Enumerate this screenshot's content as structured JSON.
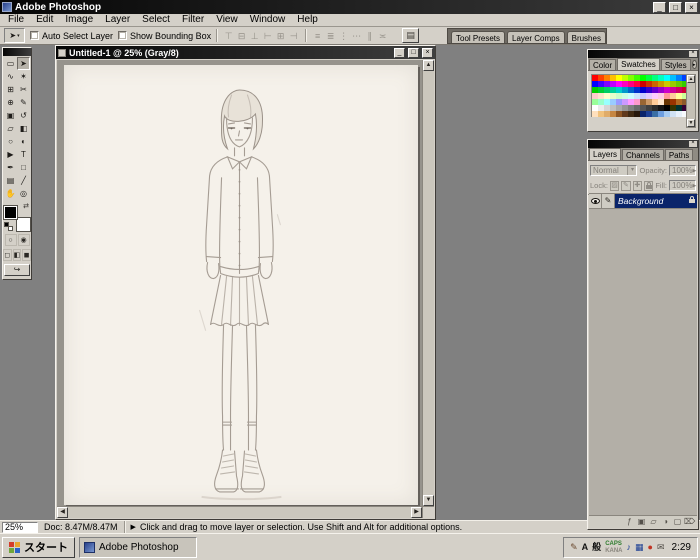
{
  "app": {
    "title": "Adobe Photoshop",
    "window_controls": [
      "_",
      "□",
      "×"
    ]
  },
  "glyphs": {
    "up": "▲",
    "down": "▼",
    "left": "◀",
    "right": "▶",
    "close": "×",
    "menu": "▸",
    "dropdown": "▾"
  },
  "menu": {
    "items": [
      "File",
      "Edit",
      "Image",
      "Layer",
      "Select",
      "Filter",
      "View",
      "Window",
      "Help"
    ]
  },
  "options": {
    "current_tool_glyph": "➤",
    "auto_select": "Auto Select Layer",
    "show_bounding": "Show Bounding Box",
    "align_group": [
      {
        "name": "align-top-edges-button",
        "glyph": "⊤"
      },
      {
        "name": "align-vertical-centers-button",
        "glyph": "⊟"
      },
      {
        "name": "align-bottom-edges-button",
        "glyph": "⊥"
      },
      {
        "name": "align-left-edges-button",
        "glyph": "⊢"
      },
      {
        "name": "align-horizontal-centers-button",
        "glyph": "⊞"
      },
      {
        "name": "align-right-edges-button",
        "glyph": "⊣"
      }
    ],
    "distribute_group": [
      {
        "name": "distribute-top-edges-button",
        "glyph": "≡"
      },
      {
        "name": "distribute-vertical-centers-button",
        "glyph": "≣"
      },
      {
        "name": "distribute-bottom-edges-button",
        "glyph": "⋮"
      },
      {
        "name": "distribute-left-edges-button",
        "glyph": "⋯"
      },
      {
        "name": "distribute-horizontal-centers-button",
        "glyph": "∥"
      },
      {
        "name": "distribute-right-edges-button",
        "glyph": "≍"
      }
    ],
    "file_browser_glyph": "▤",
    "palette_well_tabs": [
      "Tool Presets",
      "Layer Comps",
      "Brushes"
    ]
  },
  "toolbox": {
    "tools": [
      {
        "name": "rectangular-marquee-tool",
        "glyph": "▭"
      },
      {
        "name": "move-tool",
        "glyph": "➤",
        "active": true
      },
      {
        "name": "lasso-tool",
        "glyph": "∿"
      },
      {
        "name": "magic-wand-tool",
        "glyph": "✶"
      },
      {
        "name": "crop-tool",
        "glyph": "⊞"
      },
      {
        "name": "slice-tool",
        "glyph": "✂"
      },
      {
        "name": "healing-brush-tool",
        "glyph": "⊕"
      },
      {
        "name": "brush-tool",
        "glyph": "✎"
      },
      {
        "name": "clone-stamp-tool",
        "glyph": "▣"
      },
      {
        "name": "history-brush-tool",
        "glyph": "↺"
      },
      {
        "name": "eraser-tool",
        "glyph": "▱"
      },
      {
        "name": "gradient-tool",
        "glyph": "◧"
      },
      {
        "name": "blur-tool",
        "glyph": "○"
      },
      {
        "name": "dodge-tool",
        "glyph": "◐"
      },
      {
        "name": "path-selection-tool",
        "glyph": "▶"
      },
      {
        "name": "type-tool",
        "glyph": "T"
      },
      {
        "name": "pen-tool",
        "glyph": "✒"
      },
      {
        "name": "shape-tool",
        "glyph": "□"
      },
      {
        "name": "notes-tool",
        "glyph": "▤"
      },
      {
        "name": "eyedropper-tool",
        "glyph": "╱"
      },
      {
        "name": "hand-tool",
        "glyph": "✋"
      },
      {
        "name": "zoom-tool",
        "glyph": "◎"
      }
    ],
    "swap_glyph": "⇄",
    "quick_mask_glyphs": [
      "○",
      "◉"
    ],
    "screen_mode_glyphs": [
      "◻",
      "◧",
      "◼"
    ],
    "imageready_glyph": "↪"
  },
  "document": {
    "title": "Untitled-1 @ 25% (Gray/8)",
    "controls": [
      "_",
      "□",
      "×"
    ]
  },
  "status": {
    "zoom": "25%",
    "doc_size": "Doc: 8.47M/8.47M",
    "hint": "Click and drag to move layer or selection. Use Shift and Alt for additional options."
  },
  "swatches_palette": {
    "tabs": [
      "Color",
      "Swatches",
      "Styles"
    ],
    "colors": [
      "#ff0000",
      "#ff4000",
      "#ff8000",
      "#ffbf00",
      "#ffff00",
      "#bfff00",
      "#80ff00",
      "#40ff00",
      "#00ff00",
      "#00ff40",
      "#00ff80",
      "#00ffbf",
      "#00ffff",
      "#00bfff",
      "#0080ff",
      "#0040ff",
      "#0000ff",
      "#4000ff",
      "#8000ff",
      "#bf00ff",
      "#ff00ff",
      "#ff00bf",
      "#ff0080",
      "#ff0040",
      "#cc0000",
      "#cc3300",
      "#cc6600",
      "#cc9900",
      "#cccc00",
      "#99cc00",
      "#66cc00",
      "#33cc00",
      "#00cc00",
      "#00cc33",
      "#00cc66",
      "#00cc99",
      "#00cccc",
      "#0099cc",
      "#0066cc",
      "#0033cc",
      "#0000cc",
      "#3300cc",
      "#6600cc",
      "#9900cc",
      "#cc00cc",
      "#cc0099",
      "#cc0066",
      "#cc0033",
      "#ffcccc",
      "#ffe5cc",
      "#ffffcc",
      "#e5ffcc",
      "#ccffcc",
      "#ccffe5",
      "#ccffff",
      "#cce5ff",
      "#ccccff",
      "#e5ccff",
      "#ffccff",
      "#ffcce5",
      "#ff9999",
      "#ffcc99",
      "#ffff99",
      "#ccff99",
      "#99ff99",
      "#99ffcc",
      "#99ffff",
      "#99ccff",
      "#9999ff",
      "#cc99ff",
      "#ff99ff",
      "#ff99cc",
      "#996633",
      "#cc9966",
      "#ffcc99",
      "#ffe6cc",
      "#663300",
      "#993300",
      "#b36b24",
      "#8c5a2b",
      "#ffffff",
      "#ebebeb",
      "#d6d6d6",
      "#c0c0c0",
      "#ababab",
      "#969696",
      "#808080",
      "#6b6b6b",
      "#555555",
      "#404040",
      "#2b2b2b",
      "#151515",
      "#000000",
      "#333300",
      "#003333",
      "#330033",
      "#ffe0bd",
      "#f1c27d",
      "#e0ac69",
      "#c68642",
      "#8d5524",
      "#60391c",
      "#402a14",
      "#26170b",
      "#0a246a",
      "#1c3f94",
      "#3a6ea5",
      "#6d9ee0",
      "#a6caf0",
      "#d0e2f4",
      "#e8f1fa",
      "#f7fafd"
    ]
  },
  "layers_palette": {
    "tabs": [
      "Layers",
      "Channels",
      "Paths"
    ],
    "blend_mode": "Normal",
    "opacity_label": "Opacity:",
    "opacity_value": "100%",
    "lock_label": "Lock:",
    "lock_glyphs": [
      "▨",
      "✎",
      "✚"
    ],
    "fill_label": "Fill:",
    "fill_value": "100%",
    "paintbrush_glyph": "✎",
    "layers": [
      {
        "name": "Background",
        "visible": true,
        "selected": true,
        "locked": true
      }
    ],
    "buttons": [
      {
        "name": "add-layer-style-button",
        "glyph": "ƒ"
      },
      {
        "name": "add-layer-mask-button",
        "glyph": "▣"
      },
      {
        "name": "new-group-button",
        "glyph": "▱"
      },
      {
        "name": "new-adjustment-layer-button",
        "glyph": "◑"
      },
      {
        "name": "new-layer-button",
        "glyph": "▢"
      },
      {
        "name": "delete-layer-button",
        "glyph": "⌦"
      }
    ]
  },
  "taskbar": {
    "start_label": "スタート",
    "task_button_label": "Adobe Photoshop",
    "tray": {
      "icons_left": [
        {
          "name": "ime-pen-icon",
          "glyph": "✎",
          "color": "#6b4a2f"
        },
        {
          "name": "ime-input-mode-icon",
          "glyph": "A",
          "color": "#111111"
        },
        {
          "name": "ime-conversion-mode-icon",
          "glyph": "般",
          "color": "#111111"
        }
      ],
      "caps_label": "CAPS",
      "kana_label": "KANA",
      "icons_right": [
        {
          "name": "volume-icon",
          "glyph": "♪",
          "color": "#1c3f94"
        },
        {
          "name": "display-settings-icon",
          "glyph": "▦",
          "color": "#1c3f94"
        },
        {
          "name": "antivirus-icon",
          "glyph": "●",
          "color": "#c03424"
        },
        {
          "name": "mail-icon",
          "glyph": "✉",
          "color": "#55514b"
        }
      ],
      "clock": "2:29"
    }
  },
  "colors": {
    "selection": "#0a246a",
    "chrome": "#d4d0c8",
    "workspace": "#808080"
  }
}
